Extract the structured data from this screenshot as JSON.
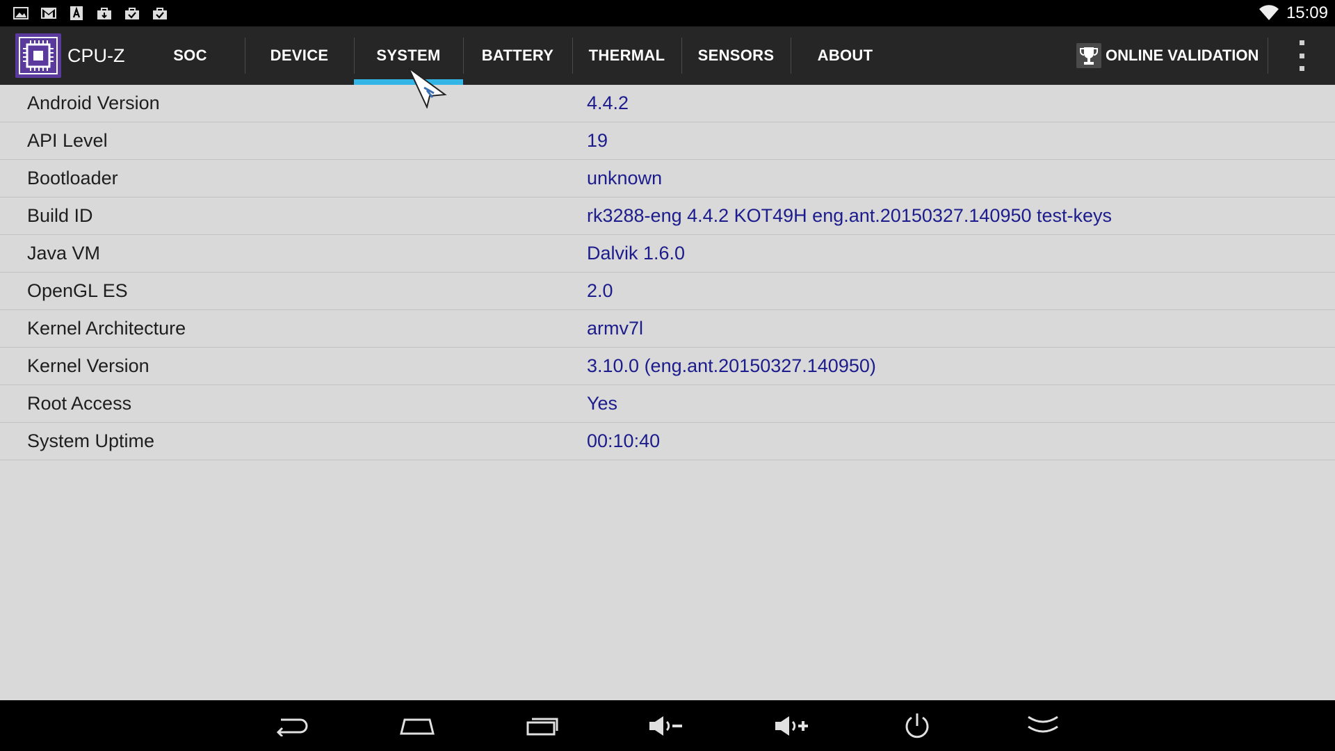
{
  "status_bar": {
    "time": "15:09",
    "notification_icons": [
      "gallery-icon",
      "gmail-icon",
      "font-icon",
      "update-icon",
      "checked-bag-icon",
      "checked-bag-icon"
    ]
  },
  "app": {
    "title": "CPU-Z",
    "tabs": [
      {
        "label": "SOC",
        "active": false
      },
      {
        "label": "DEVICE",
        "active": false
      },
      {
        "label": "SYSTEM",
        "active": true
      },
      {
        "label": "BATTERY",
        "active": false
      },
      {
        "label": "THERMAL",
        "active": false
      },
      {
        "label": "SENSORS",
        "active": false
      },
      {
        "label": "ABOUT",
        "active": false
      }
    ],
    "online_validation_label": "ONLINE VALIDATION",
    "accent_color": "#33b5e5"
  },
  "system_info": [
    {
      "label": "Android Version",
      "value": "4.4.2"
    },
    {
      "label": "API Level",
      "value": "19"
    },
    {
      "label": "Bootloader",
      "value": "unknown"
    },
    {
      "label": "Build ID",
      "value": "rk3288-eng 4.4.2 KOT49H eng.ant.20150327.140950 test-keys"
    },
    {
      "label": "Java VM",
      "value": "Dalvik 1.6.0"
    },
    {
      "label": "OpenGL ES",
      "value": "2.0"
    },
    {
      "label": "Kernel Architecture",
      "value": "armv7l"
    },
    {
      "label": "Kernel Version",
      "value": "3.10.0 (eng.ant.20150327.140950)"
    },
    {
      "label": "Root Access",
      "value": "Yes"
    },
    {
      "label": "System Uptime",
      "value": "00:10:40"
    }
  ],
  "nav_bar": {
    "buttons": [
      "back-icon",
      "home-icon",
      "recents-icon",
      "volume-down-icon",
      "volume-up-icon",
      "power-icon",
      "collapse-icon"
    ]
  }
}
